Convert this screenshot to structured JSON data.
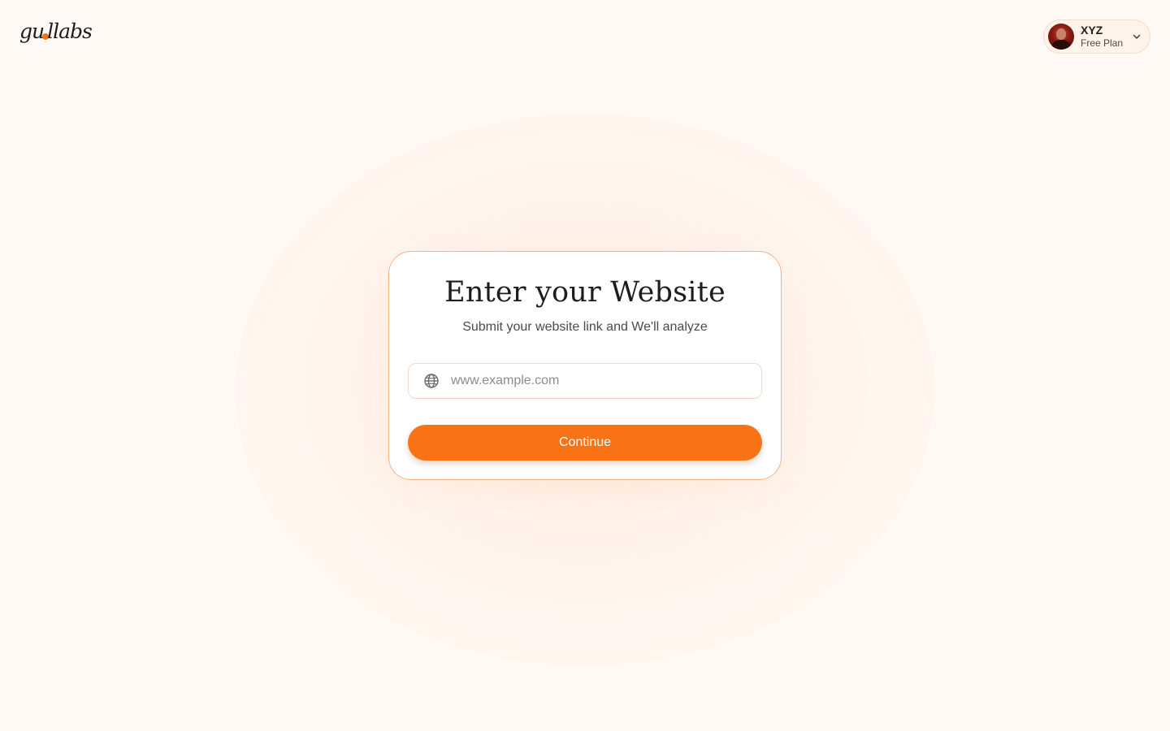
{
  "header": {
    "logo": {
      "text_before": "gu",
      "text_after": "llabs",
      "accent_color": "#f97316"
    },
    "user": {
      "name": "XYZ",
      "plan": "Free Plan",
      "avatar_icon": "user-avatar",
      "menu_icon": "chevron-down-icon"
    }
  },
  "card": {
    "title": "Enter your Website",
    "subtitle": "Submit your website link and We'll analyze",
    "url_field": {
      "icon": "globe-icon",
      "value": "",
      "placeholder": "www.example.com"
    },
    "continue_label": "Continue"
  },
  "colors": {
    "accent": "#f97316",
    "background": "#fff9f5",
    "card_border": "#f4b48a"
  }
}
